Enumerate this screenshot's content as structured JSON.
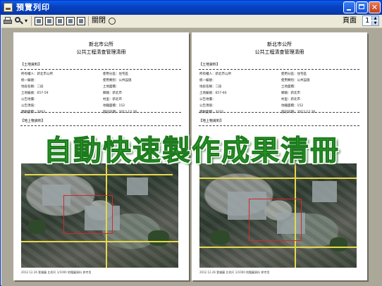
{
  "window": {
    "title": "預覽列印",
    "controls": {
      "minimize": "minimize-icon",
      "maximize": "maximize-icon",
      "close": "close-icon"
    }
  },
  "toolbar": {
    "icons": [
      "printer-icon",
      "zoom-icon",
      "one-page-icon",
      "two-pages-icon",
      "three-pages-icon",
      "four-pages-icon",
      "six-pages-icon"
    ],
    "close_label": "關閉",
    "page_label": "頁面",
    "page_value": "1"
  },
  "pages": [
    {
      "header_line1": "新北市公所",
      "header_line2": "公共工程清查管理清冊",
      "section1": "【土地資料】",
      "fields": [
        "所有權人：新北市公所",
        "使用分區：住宅區",
        "統一編號：",
        "使用類別：公共設施",
        "地段名稱：二段",
        "土地面積：",
        "土地編號：657-59",
        "鄉鎮：新北市",
        "公告地價：",
        "村里：新北市",
        "公告現值：",
        "地籍面積：152",
        "建物面積：2063",
        "登記日期：2012.12.26"
      ],
      "section2": "【地上物資料】",
      "caption": "2012.12.26 套繪圖 比例尺 1/1000 地籍圖資料 參考用"
    },
    {
      "header_line1": "新北市公所",
      "header_line2": "公共工程清查管理清冊",
      "section1": "【土地資料】",
      "fields": [
        "所有權人：新北市公所",
        "使用分區：住宅區",
        "統一編號：",
        "使用類別：公共設施",
        "地段名稱：二段",
        "土地面積：",
        "土地編號：657-60",
        "鄉鎮：新北市",
        "公告地價：",
        "村里：新北市",
        "公告現值：",
        "地籍面積：152",
        "建物面積：3102",
        "登記日期：2012.12.26"
      ],
      "section2": "【地上物資料】",
      "caption": "2012.12.26 套繪圖 比例尺 1/1000 地籍圖資料 參考用"
    }
  ],
  "overlay_text": "自動快速製作成果清冊",
  "colors": {
    "titlebar": "#0842c4",
    "banner_fill": "#2fae2f",
    "banner_outline": "#1d7a1d",
    "viewport_bg": "#aca899",
    "parcel_line": "#d02a2a",
    "road_line": "#e6d84a"
  }
}
